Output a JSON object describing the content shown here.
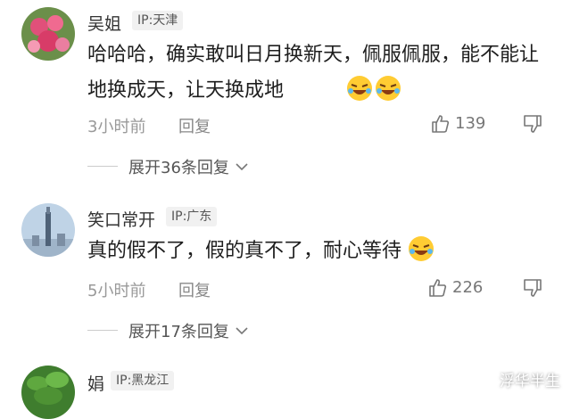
{
  "comments": [
    {
      "name": "吴姐",
      "ip": "IP:天津",
      "text": "哈哈哈，确实敢叫日月换新天，佩服佩服，能不能让地换成天，让天换成地",
      "time": "3小时前",
      "reply": "回复",
      "likes": "139",
      "expand": "展开36条回复"
    },
    {
      "name": "笑口常开",
      "ip": "IP:广东",
      "text": "真的假不了，假的真不了，耐心等待",
      "time": "5小时前",
      "reply": "回复",
      "likes": "226",
      "expand": "展开17条回复"
    },
    {
      "name": "娟",
      "ip": "IP:黑龙江"
    }
  ],
  "watermark": "浮华半生",
  "colors": {
    "text": "#1e1e1e",
    "meta": "#999999",
    "ip_bg": "#f1f1f1"
  }
}
